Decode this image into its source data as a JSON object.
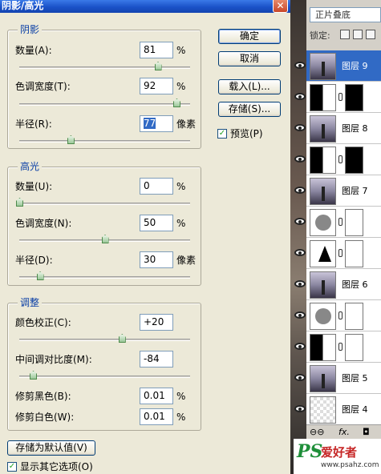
{
  "dialog": {
    "title": "阴影/高光",
    "close_glyph": "✕",
    "shadows": {
      "title": "阴影",
      "amount": {
        "label": "数量(A):",
        "value": "81",
        "unit": "%",
        "level": 0.81
      },
      "tonal_width": {
        "label": "色调宽度(T):",
        "value": "92",
        "unit": "%",
        "level": 0.92
      },
      "radius": {
        "label": "半径(R):",
        "value": "77",
        "unit": "像素",
        "level": 0.3
      }
    },
    "highlights": {
      "title": "高光",
      "amount": {
        "label": "数量(U):",
        "value": "0",
        "unit": "%",
        "level": 0.0
      },
      "tonal_width": {
        "label": "色调宽度(N):",
        "value": "50",
        "unit": "%",
        "level": 0.5
      },
      "radius": {
        "label": "半径(D):",
        "value": "30",
        "unit": "像素",
        "level": 0.12
      }
    },
    "adjustments": {
      "title": "调整",
      "color_correction": {
        "label": "颜色校正(C):",
        "value": "+20",
        "level": 0.6
      },
      "midtone_contrast": {
        "label": "中间调对比度(M):",
        "value": "-84",
        "level": 0.08
      },
      "black_clip": {
        "label": "修剪黑色(B):",
        "value": "0.01",
        "unit": "%"
      },
      "white_clip": {
        "label": "修剪白色(W):",
        "value": "0.01",
        "unit": "%"
      }
    },
    "buttons": {
      "ok": "确定",
      "cancel": "取消",
      "load": "载入(L)...",
      "save": "存储(S)...",
      "save_default": "存储为默认值(V)"
    },
    "preview": {
      "label": "预览(P)",
      "checked": true
    },
    "show_more": {
      "label": "显示其它选项(O)",
      "checked": true
    }
  },
  "layers_panel": {
    "blend_mode": "正片叠底",
    "lock_label": "锁定:",
    "layers": [
      {
        "name": "图层 9",
        "kind": "image",
        "active": true
      },
      {
        "name": "",
        "kind": "adjust-dark",
        "mask": "black"
      },
      {
        "name": "图层 8",
        "kind": "image"
      },
      {
        "name": "",
        "kind": "adjust-dark",
        "mask": "black"
      },
      {
        "name": "图层 7",
        "kind": "image"
      },
      {
        "name": "",
        "kind": "adjust-circ",
        "mask": "white"
      },
      {
        "name": "",
        "kind": "adjust-tri",
        "mask": "white"
      },
      {
        "name": "图层 6",
        "kind": "image"
      },
      {
        "name": "",
        "kind": "adjust-circ",
        "mask": "white"
      },
      {
        "name": "",
        "kind": "adjust-dark",
        "mask": "white"
      },
      {
        "name": "图层 5",
        "kind": "image"
      },
      {
        "name": "图层 4",
        "kind": "blank"
      }
    ],
    "footer": {
      "link": "⊖⊖",
      "fx": "fx.",
      "mask": "◘"
    }
  },
  "watermark": {
    "logo": "PS",
    "text": "爱好者",
    "url": "www.psahz.com"
  },
  "colors": {
    "accent": "#316ac5",
    "title_bar": "#1b52c8",
    "group_title": "#0a3fa6",
    "thumb_green": "#4c8a4a"
  }
}
